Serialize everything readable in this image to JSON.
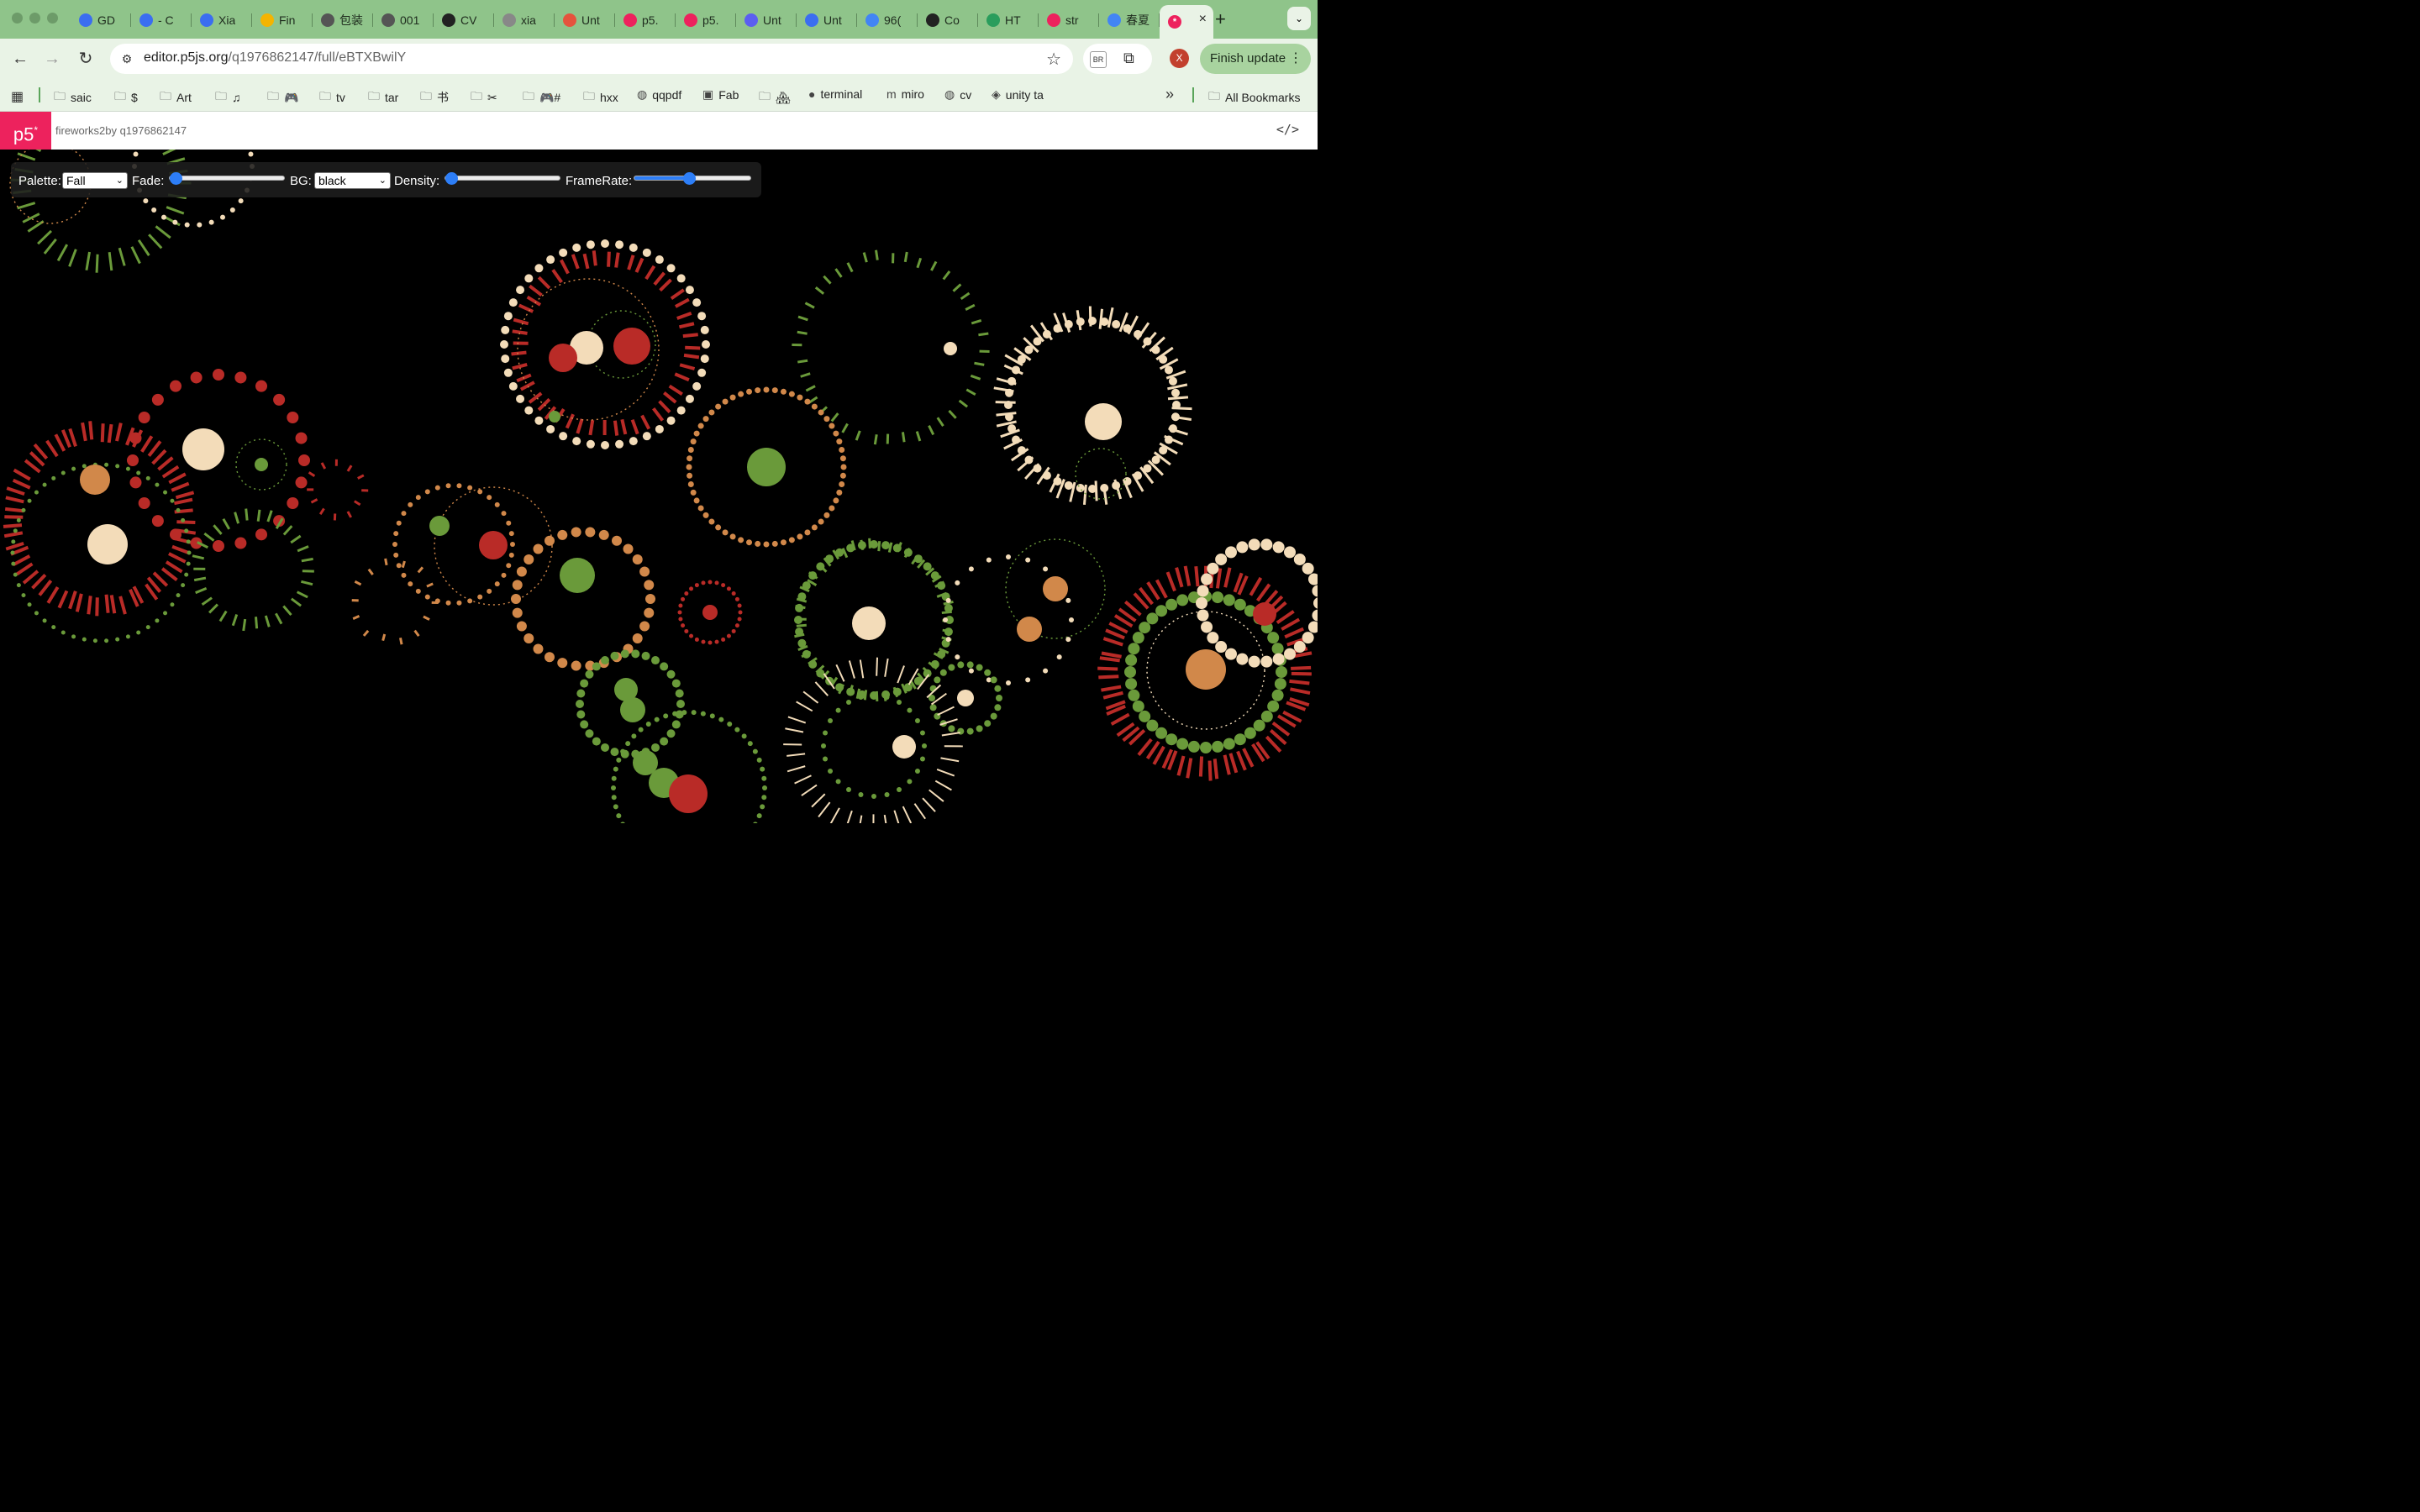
{
  "window": {
    "tabs": [
      {
        "label": "GD",
        "icon": "doc-icon",
        "color": "#3b6ef0"
      },
      {
        "label": "- C",
        "icon": "copilot-icon",
        "color": "#3b6ef0"
      },
      {
        "label": "Xia",
        "icon": "doc-icon",
        "color": "#3b6ef0"
      },
      {
        "label": "Fin",
        "icon": "drive-icon",
        "color": "#f4b400"
      },
      {
        "label": "包装",
        "icon": "globe-icon",
        "color": "#555"
      },
      {
        "label": "001",
        "icon": "globe-icon",
        "color": "#555"
      },
      {
        "label": "CV",
        "icon": "globe-icon",
        "color": "#222"
      },
      {
        "label": "xia",
        "icon": "globe-icon",
        "color": "#888"
      },
      {
        "label": "Unt",
        "icon": "figma-icon",
        "color": "#e5533d"
      },
      {
        "label": "p5.",
        "icon": "p5-asterisk-icon",
        "color": "#ed225d"
      },
      {
        "label": "p5.",
        "icon": "p5-asterisk-icon",
        "color": "#ed225d"
      },
      {
        "label": "Unt",
        "icon": "video-icon",
        "color": "#5b5ff0"
      },
      {
        "label": "Unt",
        "icon": "copilot-icon",
        "color": "#3b6ef0"
      },
      {
        "label": "96(",
        "icon": "google-icon",
        "color": "#4285f4"
      },
      {
        "label": "Co",
        "icon": "openai-icon",
        "color": "#222"
      },
      {
        "label": "HT",
        "icon": "w-icon",
        "color": "#2a9d5c"
      },
      {
        "label": "str",
        "icon": "p5-asterisk-icon",
        "color": "#ed225d"
      },
      {
        "label": "春夏",
        "icon": "google-icon",
        "color": "#4285f4"
      }
    ],
    "active_tab": {
      "icon": "p5-asterisk-icon",
      "close": "×"
    },
    "new_tab": "+",
    "tab_menu": "⌄"
  },
  "toolbar": {
    "url_host": "editor.p5js.org",
    "url_path": "/q1976862147/full/eBTXBwilY",
    "ext_label": "BR",
    "avatar_letter": "X",
    "finish_update": "Finish update"
  },
  "bookmarks": {
    "items": [
      {
        "label": "saic",
        "icon": "folder-icon"
      },
      {
        "label": "$",
        "icon": "folder-icon"
      },
      {
        "label": "Art",
        "icon": "folder-icon"
      },
      {
        "label": "♫",
        "icon": "folder-icon"
      },
      {
        "label": "🎮",
        "icon": "folder-icon"
      },
      {
        "label": "tv",
        "icon": "folder-icon"
      },
      {
        "label": "tar",
        "icon": "folder-icon"
      },
      {
        "label": "书",
        "icon": "folder-icon"
      },
      {
        "label": "✂",
        "icon": "folder-icon"
      },
      {
        "label": "🎮#",
        "icon": "folder-icon"
      },
      {
        "label": "hxx",
        "icon": "folder-icon"
      },
      {
        "label": "qqpdf",
        "icon": "globe-icon"
      },
      {
        "label": "Fab",
        "icon": "fab-icon"
      },
      {
        "label": "🏘",
        "icon": "folder-icon"
      },
      {
        "label": "terminal",
        "icon": "github-icon"
      },
      {
        "label": "miro",
        "icon": "miro-icon"
      },
      {
        "label": "cv",
        "icon": "globe-icon"
      },
      {
        "label": "unity ta",
        "icon": "unity-icon"
      }
    ],
    "overflow": "»",
    "all_bookmarks": "All Bookmarks"
  },
  "p5": {
    "logo": "p5",
    "sketch_title": "fireworks2by q1976862147",
    "code_toggle": "</>"
  },
  "controls": {
    "palette_label": "Palette:",
    "palette_value": "Fall",
    "fade_label": "Fade:",
    "fade_level": 0.0,
    "bg_label": "BG:",
    "bg_value": "black",
    "density_label": "Density:",
    "density_level": 0.0,
    "framerate_label": "FrameRate:",
    "framerate_level": 0.46
  },
  "colors": {
    "cream": "#f3dcb9",
    "red": "#b92b27",
    "orange": "#d1884a",
    "green": "#6a9a3a",
    "accent_blue": "#2d7ef7",
    "p5_pink": "#ed225d"
  }
}
